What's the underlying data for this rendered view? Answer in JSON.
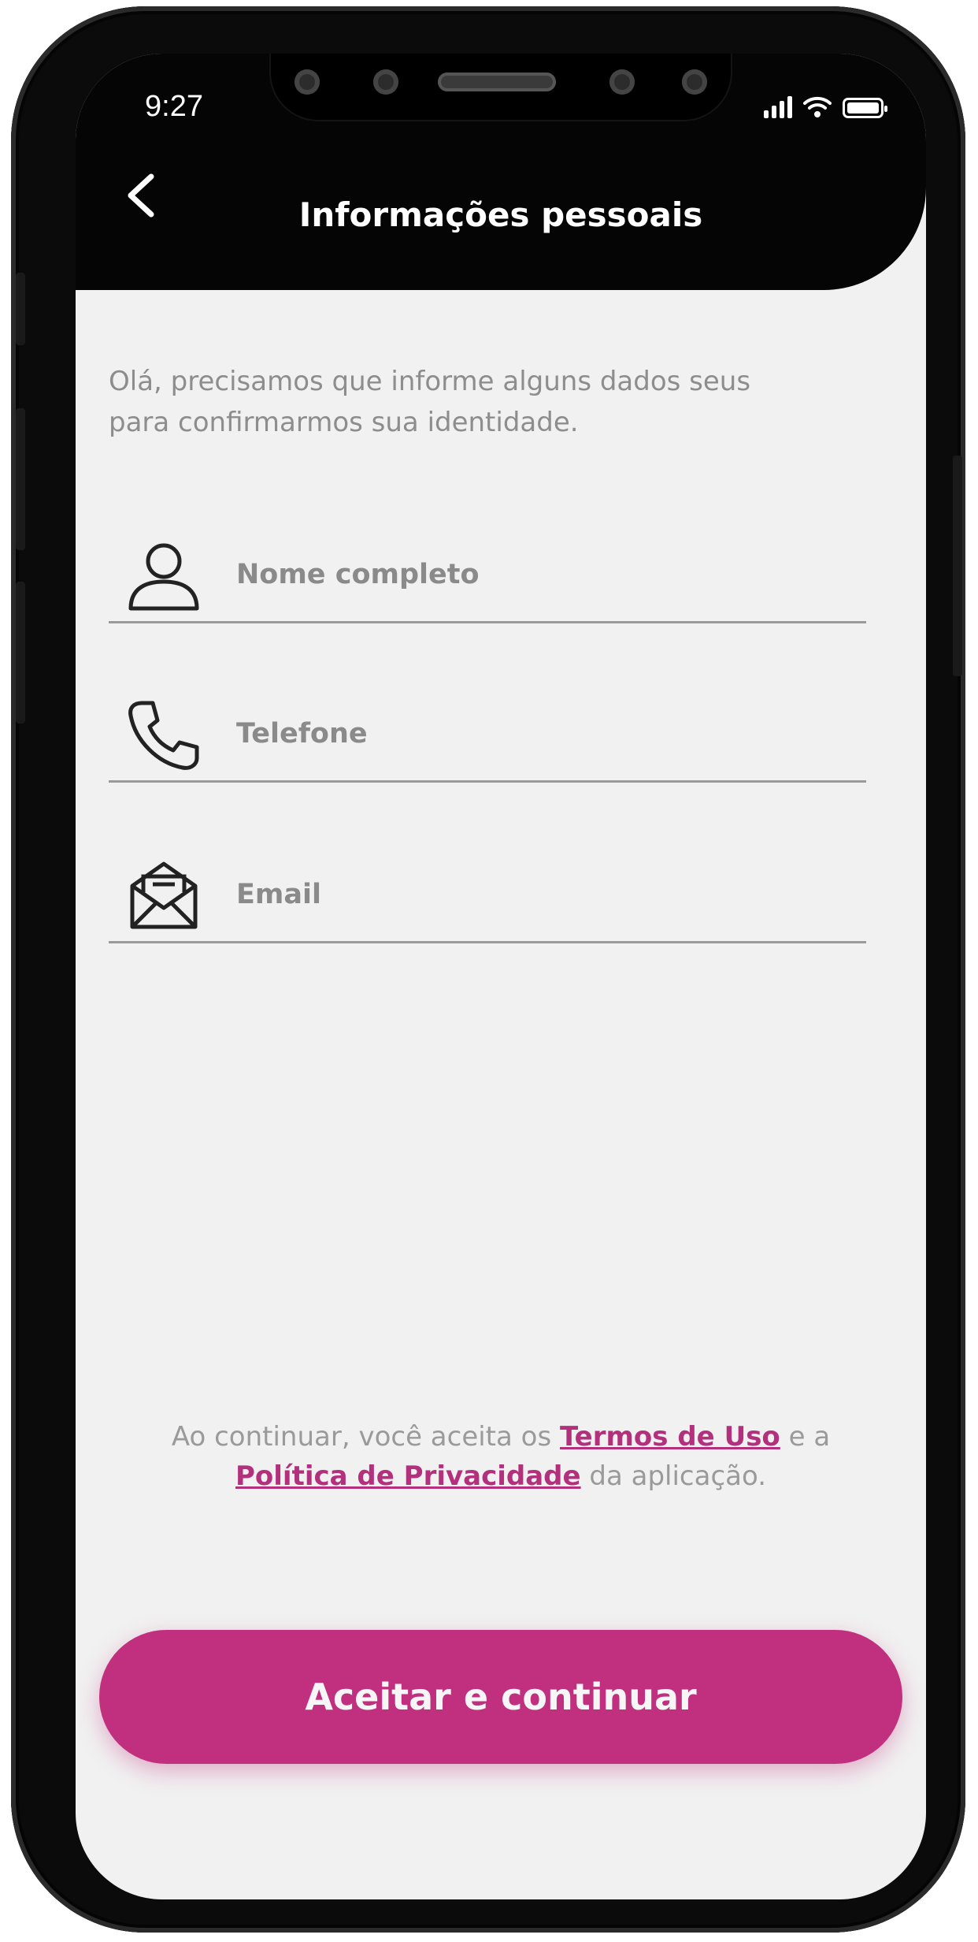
{
  "status_bar": {
    "time": "9:27"
  },
  "header": {
    "title": "Informações pessoais"
  },
  "intro": "Olá, precisamos que informe alguns dados seus para confirmarmos sua identidade.",
  "fields": {
    "name": {
      "placeholder": "Nome completo",
      "icon": "person-icon"
    },
    "phone": {
      "placeholder": "Telefone",
      "icon": "phone-icon"
    },
    "email": {
      "placeholder": "Email",
      "icon": "mail-icon"
    }
  },
  "terms": {
    "prefix": "Ao continuar, você aceita os ",
    "terms_link": "Termos de Uso",
    "middle": " e  a ",
    "privacy_link": "Política de Privacidade",
    "suffix": " da aplicação."
  },
  "cta": {
    "label": "Aceitar e continuar"
  },
  "colors": {
    "accent": "#c1307f",
    "header_bg": "#050505",
    "screen_bg": "#f1f1f1"
  }
}
